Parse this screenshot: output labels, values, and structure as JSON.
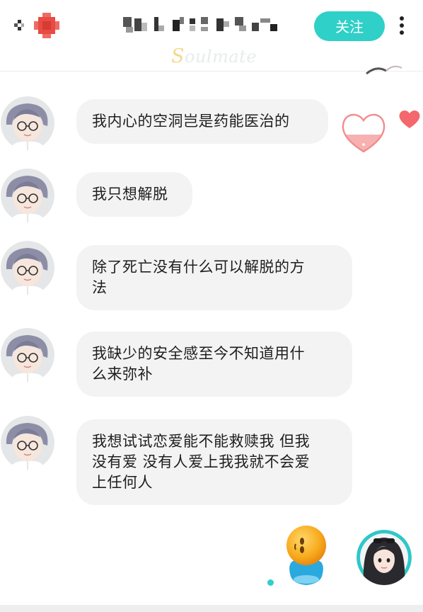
{
  "header": {
    "follow_label": "关注",
    "brand_first_letter": "S",
    "brand_rest": "oulmate"
  },
  "messages": [
    {
      "text": "我内心的空洞岂是药能医治的"
    },
    {
      "text": "我只想解脱"
    },
    {
      "text": "除了死亡没有什么可以解脱的方\n法"
    },
    {
      "text": "我缺少的安全感至今不知道用什\n么来弥补"
    },
    {
      "text": "我想试试恋爱能不能救赎我 但我\n没有爱 没有人爱上我我就不会爱\n上任何人"
    }
  ],
  "icons": {
    "back": "back-arrow-icon",
    "more": "more-vertical-icon",
    "like": "heart-icon"
  },
  "colors": {
    "accent": "#2fd0c8",
    "bubble": "#f3f3f3",
    "like": "#f4686d"
  }
}
